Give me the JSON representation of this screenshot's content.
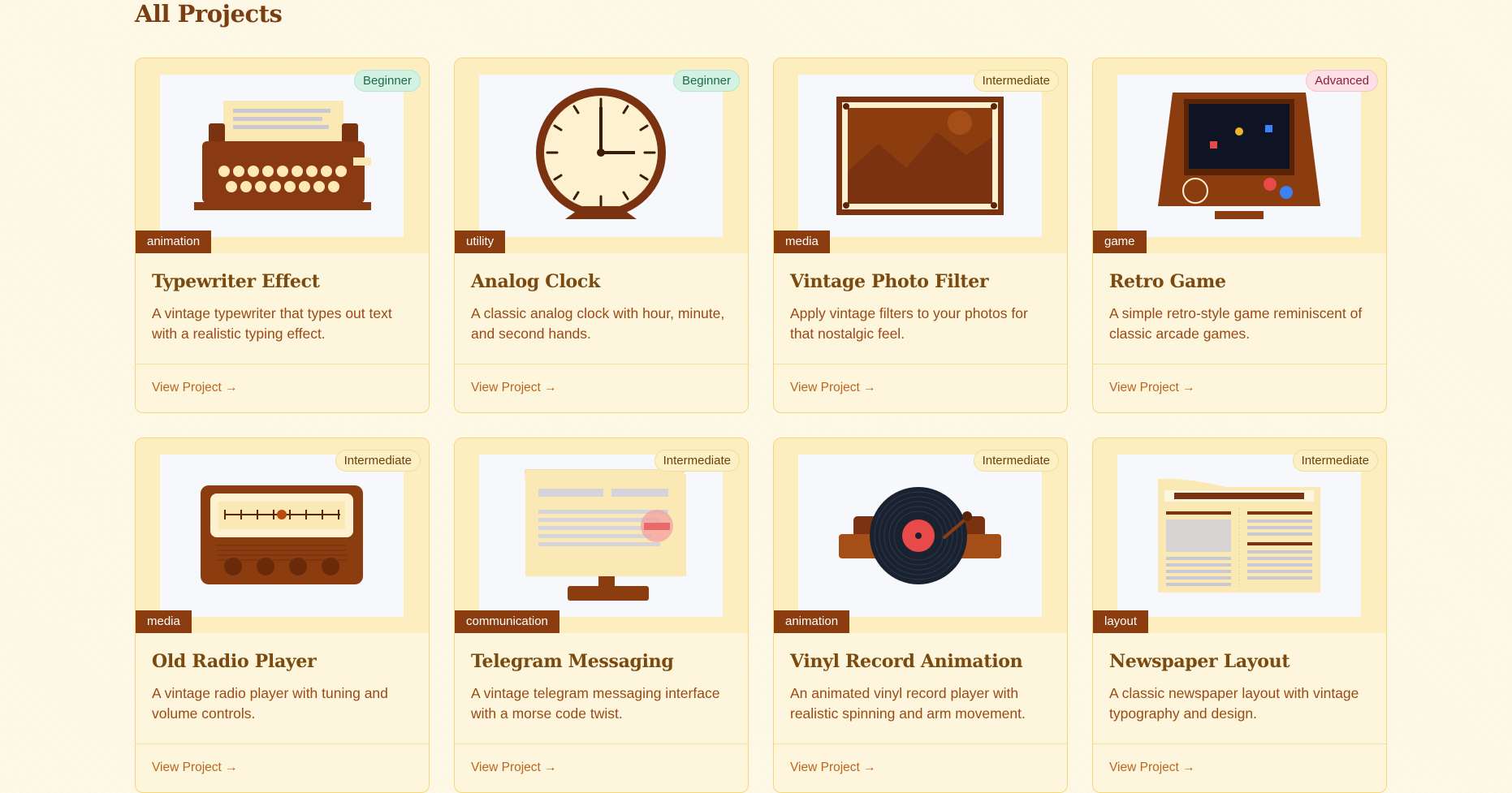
{
  "section": {
    "title": "All Projects"
  },
  "projects": [
    {
      "title": "Typewriter Effect",
      "description": "A vintage typewriter that types out text with a realistic typing effect.",
      "category": "animation",
      "difficulty": "Beginner",
      "link": "View Project →",
      "icon": "typewriter-icon"
    },
    {
      "title": "Analog Clock",
      "description": "A classic analog clock with hour, minute, and second hands.",
      "category": "utility",
      "difficulty": "Beginner",
      "link": "View Project →",
      "icon": "clock-icon"
    },
    {
      "title": "Vintage Photo Filter",
      "description": "Apply vintage filters to your photos for that nostalgic feel.",
      "category": "media",
      "difficulty": "Intermediate",
      "link": "View Project →",
      "icon": "photo-frame-icon"
    },
    {
      "title": "Retro Game",
      "description": "A simple retro-style game reminiscent of classic arcade games.",
      "category": "game",
      "difficulty": "Advanced",
      "link": "View Project →",
      "icon": "arcade-icon"
    },
    {
      "title": "Old Radio Player",
      "description": "A vintage radio player with tuning and volume controls.",
      "category": "media",
      "difficulty": "Intermediate",
      "link": "View Project →",
      "icon": "radio-icon"
    },
    {
      "title": "Telegram Messaging",
      "description": "A vintage telegram messaging interface with a morse code twist.",
      "category": "communication",
      "difficulty": "Intermediate",
      "link": "View Project →",
      "icon": "telegram-icon"
    },
    {
      "title": "Vinyl Record Animation",
      "description": "An animated vinyl record player with realistic spinning and arm movement.",
      "category": "animation",
      "difficulty": "Intermediate",
      "link": "View Project →",
      "icon": "vinyl-record-icon"
    },
    {
      "title": "Newspaper Layout",
      "description": "A classic newspaper layout with vintage typography and design.",
      "category": "layout",
      "difficulty": "Intermediate",
      "link": "View Project →",
      "icon": "newspaper-icon"
    }
  ],
  "colors": {
    "accent": "#8c3d0f",
    "background": "#fef9e7",
    "card": "#fef6dc",
    "border": "#f4d77a"
  }
}
